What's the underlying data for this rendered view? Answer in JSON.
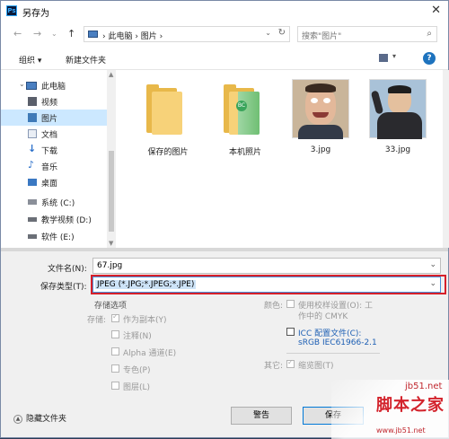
{
  "window": {
    "title": "另存为",
    "app_icon": "Ps"
  },
  "address": {
    "crumbs": "› 此电脑 › 图片 ›",
    "search_placeholder": "搜索\"图片\""
  },
  "toolbar": {
    "organize": "组织 ▾",
    "new_folder": "新建文件夹"
  },
  "nav_items": [
    {
      "label": "此电脑",
      "icon": "pc-icon"
    },
    {
      "label": "视频",
      "icon": "video-icon"
    },
    {
      "label": "图片",
      "icon": "pictures-icon",
      "selected": true
    },
    {
      "label": "文档",
      "icon": "documents-icon"
    },
    {
      "label": "下载",
      "icon": "download-icon"
    },
    {
      "label": "音乐",
      "icon": "music-icon"
    },
    {
      "label": "桌面",
      "icon": "desktop-icon"
    },
    {
      "label": "系统 (C:)",
      "icon": "drive-icon"
    },
    {
      "label": "教学视频 (D:)",
      "icon": "drive-icon"
    },
    {
      "label": "软件 (E:)",
      "icon": "drive-icon"
    }
  ],
  "files": [
    {
      "label": "保存的图片",
      "kind": "folder"
    },
    {
      "label": "本机照片",
      "kind": "folder-photos"
    },
    {
      "label": "3.jpg",
      "kind": "image"
    },
    {
      "label": "33.jpg",
      "kind": "image"
    }
  ],
  "form": {
    "filename_label": "文件名(N):",
    "filename_value": "67.jpg",
    "type_label": "保存类型(T):",
    "type_value": "JPEG (*.JPG;*.JPEG;*.JPE)"
  },
  "options": {
    "section_title": "存储选项",
    "store_label": "存储:",
    "as_copy": "作为副本(Y)",
    "notes": "注释(N)",
    "alpha": "Alpha 通道(E)",
    "spot": "专色(P)",
    "layers": "图层(L)",
    "color_label": "颜色:",
    "proof_setup": "使用校样设置(O): 工",
    "proof_setup_2": "作中的 CMYK",
    "icc": "ICC 配置文件(C):",
    "icc_2": "sRGB IEC61966-2.1",
    "other_label": "其它:",
    "thumbnail": "缩览图(T)"
  },
  "footer": {
    "hide_folders": "隐藏文件夹",
    "warning_btn": "警告",
    "save_btn": "保存"
  },
  "watermark": {
    "site": "jb51.net",
    "brand": "脚本之家",
    "url": "www.jb51.net"
  },
  "colors": {
    "selection": "#cce8ff",
    "highlight_box": "#d6202a",
    "accent": "#1e73be"
  }
}
